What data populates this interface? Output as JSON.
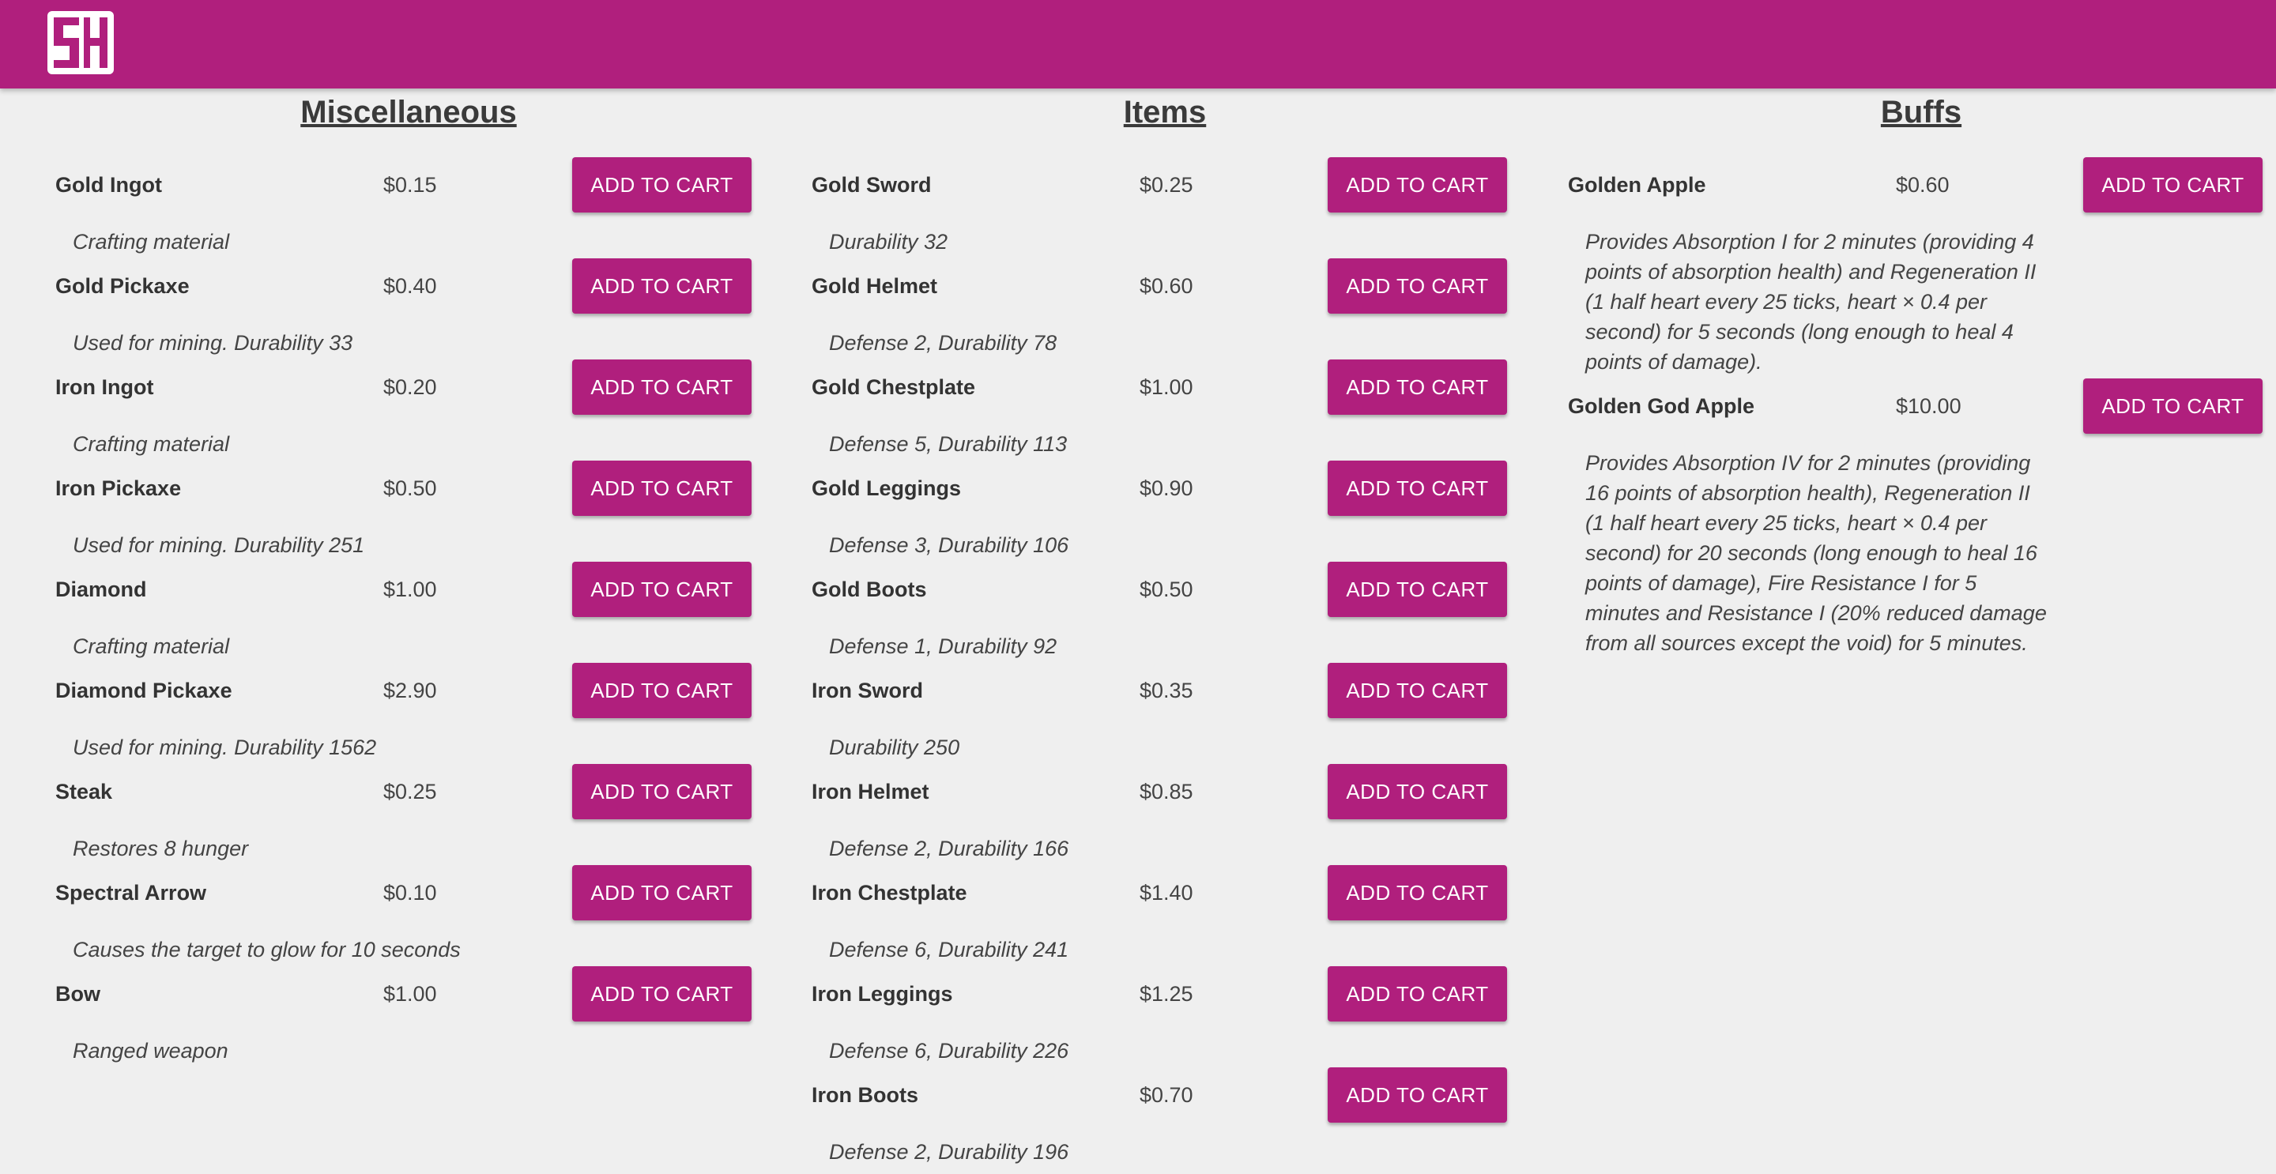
{
  "header": {
    "logo_alt": "logo",
    "brand_color": "#b01f7d"
  },
  "add_label": "ADD TO CART",
  "columns": [
    {
      "title": "Miscellaneous",
      "items": [
        {
          "name": "Gold Ingot",
          "price": "$0.15",
          "desc": "Crafting material"
        },
        {
          "name": "Gold Pickaxe",
          "price": "$0.40",
          "desc": "Used for mining. Durability 33"
        },
        {
          "name": "Iron Ingot",
          "price": "$0.20",
          "desc": "Crafting material"
        },
        {
          "name": "Iron Pickaxe",
          "price": "$0.50",
          "desc": "Used for mining. Durability 251"
        },
        {
          "name": "Diamond",
          "price": "$1.00",
          "desc": "Crafting material"
        },
        {
          "name": "Diamond Pickaxe",
          "price": "$2.90",
          "desc": "Used for mining. Durability 1562"
        },
        {
          "name": "Steak",
          "price": "$0.25",
          "desc": "Restores 8 hunger"
        },
        {
          "name": "Spectral Arrow",
          "price": "$0.10",
          "desc": "Causes the target to glow for 10 seconds"
        },
        {
          "name": "Bow",
          "price": "$1.00",
          "desc": "Ranged weapon"
        }
      ]
    },
    {
      "title": "Items",
      "items": [
        {
          "name": "Gold Sword",
          "price": "$0.25",
          "desc": "Durability 32"
        },
        {
          "name": "Gold Helmet",
          "price": "$0.60",
          "desc": "Defense 2, Durability 78"
        },
        {
          "name": "Gold Chestplate",
          "price": "$1.00",
          "desc": "Defense 5, Durability 113"
        },
        {
          "name": "Gold Leggings",
          "price": "$0.90",
          "desc": "Defense 3, Durability 106"
        },
        {
          "name": "Gold Boots",
          "price": "$0.50",
          "desc": "Defense 1, Durability 92"
        },
        {
          "name": "Iron Sword",
          "price": "$0.35",
          "desc": "Durability 250"
        },
        {
          "name": "Iron Helmet",
          "price": "$0.85",
          "desc": "Defense 2, Durability 166"
        },
        {
          "name": "Iron Chestplate",
          "price": "$1.40",
          "desc": "Defense 6, Durability 241"
        },
        {
          "name": "Iron Leggings",
          "price": "$1.25",
          "desc": "Defense 6, Durability 226"
        },
        {
          "name": "Iron Boots",
          "price": "$0.70",
          "desc": "Defense 2, Durability 196"
        }
      ]
    },
    {
      "title": "Buffs",
      "items": [
        {
          "name": "Golden Apple",
          "price": "$0.60",
          "desc": "Provides Absorption I for 2 minutes (providing 4 points of absorption health) and Regeneration II (1 half heart every 25 ticks, heart × 0.4 per second) for 5 seconds (long enough to heal 4 points of damage)."
        },
        {
          "name": "Golden God Apple",
          "price": "$10.00",
          "desc": "Provides Absorption IV for 2 minutes (providing 16 points of absorption health), Regeneration II (1 half heart every 25 ticks, heart × 0.4 per second) for 20 seconds (long enough to heal 16 points of damage), Fire Resistance I for 5 minutes and Resistance I (20% reduced damage from all sources except the void) for 5 minutes."
        }
      ]
    }
  ]
}
